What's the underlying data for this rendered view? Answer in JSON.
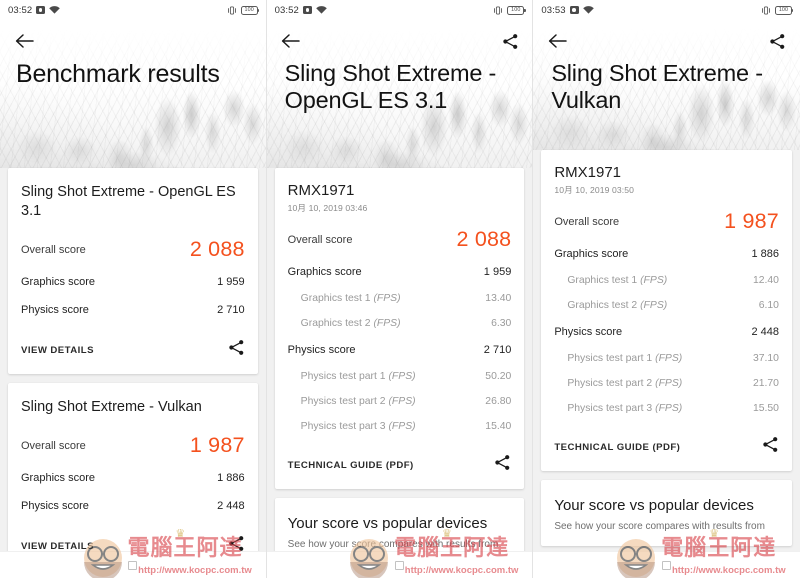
{
  "panels": [
    {
      "id": "panel-benchmark-results",
      "statusbar": {
        "time": "03:52",
        "screenshot_icon": "screenshot-icon",
        "wifi_icon": "wifi-icon",
        "vibrate_icon": "vibrate-icon",
        "battery_level": "100"
      },
      "header": {
        "back_icon": "back-arrow-icon",
        "share_icon": "share-icon",
        "show_share": false,
        "title": "Benchmark results"
      },
      "cards": [
        {
          "title": "Sling Shot Extreme - OpenGL ES 3.1",
          "rows": [
            {
              "label": "Overall score",
              "value": "2 088",
              "style": "overall"
            },
            {
              "label": "Graphics score",
              "value": "1 959",
              "style": "major"
            },
            {
              "label": "Physics score",
              "value": "2 710",
              "style": "major"
            }
          ],
          "footer": {
            "label": "VIEW DETAILS",
            "share_icon": "share-icon"
          }
        },
        {
          "title": "Sling Shot Extreme - Vulkan",
          "rows": [
            {
              "label": "Overall score",
              "value": "1 987",
              "style": "overall"
            },
            {
              "label": "Graphics score",
              "value": "1 886",
              "style": "major"
            },
            {
              "label": "Physics score",
              "value": "2 448",
              "style": "major"
            }
          ],
          "footer": {
            "label": "VIEW DETAILS",
            "share_icon": "share-icon"
          }
        }
      ],
      "navbar": {
        "square_icon": "recents-square-icon"
      }
    },
    {
      "id": "panel-opengl-detail",
      "statusbar": {
        "time": "03:52",
        "screenshot_icon": "screenshot-icon",
        "wifi_icon": "wifi-icon",
        "vibrate_icon": "vibrate-icon",
        "battery_level": "100"
      },
      "header": {
        "back_icon": "back-arrow-icon",
        "share_icon": "share-icon",
        "show_share": true,
        "title": "Sling Shot Extreme - OpenGL ES 3.1"
      },
      "device": {
        "name": "RMX1971",
        "date": "10月 10, 2019 03:46"
      },
      "rows": [
        {
          "label": "Overall score",
          "value": "2 088",
          "style": "overall"
        },
        {
          "label": "Graphics score",
          "value": "1 959",
          "style": "major"
        },
        {
          "label": "Graphics test 1",
          "unit": "(FPS)",
          "value": "13.40",
          "style": "sub"
        },
        {
          "label": "Graphics test 2",
          "unit": "(FPS)",
          "value": "6.30",
          "style": "sub"
        },
        {
          "label": "Physics score",
          "value": "2 710",
          "style": "major"
        },
        {
          "label": "Physics test part 1",
          "unit": "(FPS)",
          "value": "50.20",
          "style": "sub"
        },
        {
          "label": "Physics test part 2",
          "unit": "(FPS)",
          "value": "26.80",
          "style": "sub"
        },
        {
          "label": "Physics test part 3",
          "unit": "(FPS)",
          "value": "15.40",
          "style": "sub"
        }
      ],
      "footer": {
        "label": "TECHNICAL GUIDE (PDF)",
        "share_icon": "share-icon"
      },
      "vs_section": {
        "title": "Your score vs popular devices",
        "subtitle": "See how your score compares with results from"
      },
      "navbar": {
        "square_icon": "recents-square-icon"
      }
    },
    {
      "id": "panel-vulkan-detail",
      "statusbar": {
        "time": "03:53",
        "screenshot_icon": "screenshot-icon",
        "wifi_icon": "wifi-icon",
        "vibrate_icon": "vibrate-icon",
        "battery_level": "100"
      },
      "header": {
        "back_icon": "back-arrow-icon",
        "share_icon": "share-icon",
        "show_share": true,
        "title": "Sling Shot Extreme - Vulkan"
      },
      "device": {
        "name": "RMX1971",
        "date": "10月 10, 2019 03:50"
      },
      "rows": [
        {
          "label": "Overall score",
          "value": "1 987",
          "style": "overall"
        },
        {
          "label": "Graphics score",
          "value": "1 886",
          "style": "major"
        },
        {
          "label": "Graphics test 1",
          "unit": "(FPS)",
          "value": "12.40",
          "style": "sub"
        },
        {
          "label": "Graphics test 2",
          "unit": "(FPS)",
          "value": "6.10",
          "style": "sub"
        },
        {
          "label": "Physics score",
          "value": "2 448",
          "style": "major"
        },
        {
          "label": "Physics test part 1",
          "unit": "(FPS)",
          "value": "37.10",
          "style": "sub"
        },
        {
          "label": "Physics test part 2",
          "unit": "(FPS)",
          "value": "21.70",
          "style": "sub"
        },
        {
          "label": "Physics test part 3",
          "unit": "(FPS)",
          "value": "15.50",
          "style": "sub"
        }
      ],
      "footer": {
        "label": "TECHNICAL GUIDE (PDF)",
        "share_icon": "share-icon"
      },
      "vs_section": {
        "title": "Your score vs popular devices",
        "subtitle": "See how your score compares with results from"
      },
      "navbar": {
        "square_icon": "recents-square-icon"
      }
    }
  ],
  "watermark": {
    "text": "電腦王阿達",
    "url": "http://www.kocpc.com.tw"
  },
  "colors": {
    "accent_orange": "#f4511e",
    "watermark_red": "#d9434a",
    "text_primary": "#1d1d1d",
    "text_secondary": "#9a9a9a"
  }
}
